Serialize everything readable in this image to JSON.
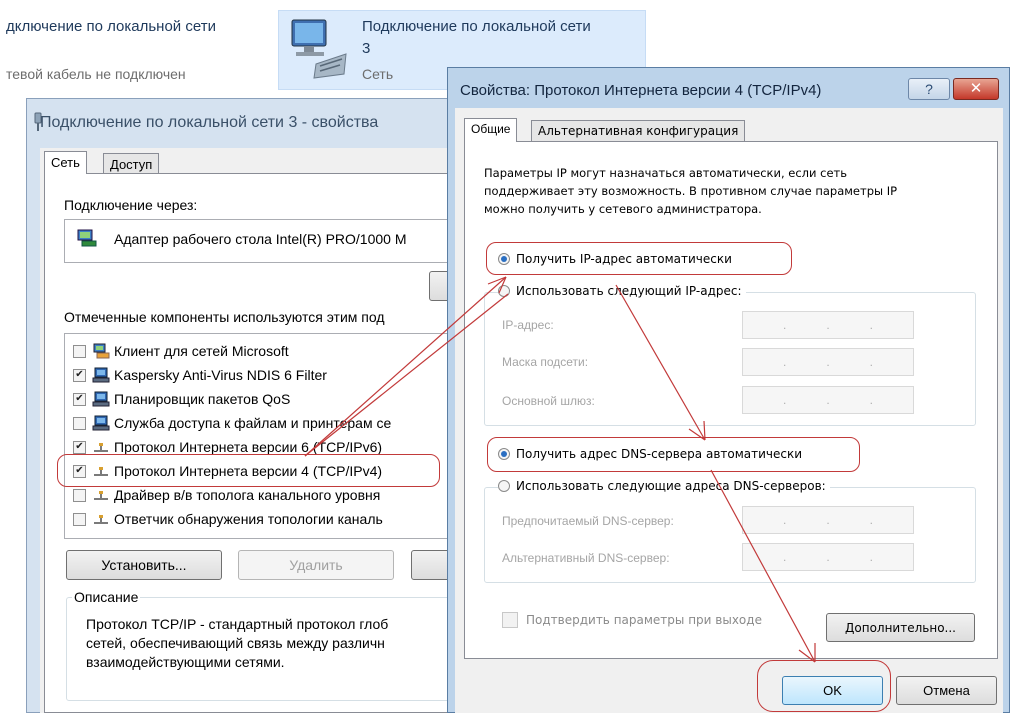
{
  "top_strip": {
    "item1_title": "дключение по локальной сети",
    "item1_status": "тевой кабель не подключен",
    "item2_title_line1": "Подключение по локальной сети",
    "item2_title_line2": "3",
    "item2_status": "Сеть"
  },
  "properties_window": {
    "title": "Подключение по локальной сети 3 - свойства",
    "tabs": [
      "Сеть",
      "Доступ"
    ],
    "connect_via_label": "Подключение через:",
    "adapter_name": "Адаптер рабочего стола Intel(R) PRO/1000 M",
    "components_label": "Отмеченные компоненты используются этим под",
    "components": [
      {
        "label": "Клиент для сетей Microsoft",
        "checked": false,
        "icon": "network-client-icon"
      },
      {
        "label": "Kaspersky Anti-Virus NDIS 6 Filter",
        "checked": true,
        "icon": "network-service-icon"
      },
      {
        "label": "Планировщик пакетов QoS",
        "checked": true,
        "icon": "network-service-icon"
      },
      {
        "label": "Служба доступа к файлам и принтерам се",
        "checked": false,
        "icon": "network-service-icon"
      },
      {
        "label": "Протокол Интернета версии 6 (TCP/IPv6)",
        "checked": true,
        "icon": "protocol-icon"
      },
      {
        "label": "Протокол Интернета версии 4 (TCP/IPv4)",
        "checked": true,
        "icon": "protocol-icon"
      },
      {
        "label": "Драйвер в/в тополога канального уровня",
        "checked": false,
        "icon": "protocol-icon"
      },
      {
        "label": "Ответчик обнаружения топологии каналь",
        "checked": false,
        "icon": "protocol-icon"
      }
    ],
    "install_button": "Установить...",
    "remove_button": "Удалить",
    "description_legend": "Описание",
    "description_text_1": "Протокол TCP/IP - стандартный протокол глоб",
    "description_text_2": "сетей, обеспечивающий связь между различн",
    "description_text_3": "взаимодействующими сетями."
  },
  "ipv4_dialog": {
    "title": "Свойства: Протокол Интернета версии 4 (TCP/IPv4)",
    "help_button": "?",
    "close_button": "✕",
    "tabs": [
      "Общие",
      "Альтернативная конфигурация"
    ],
    "intro_1": "Параметры IP могут назначаться автоматически, если сеть",
    "intro_2": "поддерживает эту возможность. В противном случае параметры IP",
    "intro_3": "можно получить у сетевого администратора.",
    "radio_ip_auto": "Получить IP-адрес автоматически",
    "radio_ip_manual": "Использовать следующий IP-адрес:",
    "ip_address_label": "IP-адрес:",
    "subnet_label": "Маска подсети:",
    "gateway_label": "Основной шлюз:",
    "radio_dns_auto": "Получить адрес DNS-сервера автоматически",
    "radio_dns_manual": "Использовать следующие адреса DNS-серверов:",
    "preferred_dns_label": "Предпочитаемый DNS-сервер:",
    "alternate_dns_label": "Альтернативный DNS-сервер:",
    "ip_dot": ".",
    "validate_checkbox": "Подтвердить параметры при выходе",
    "advanced_button": "Дополнительно...",
    "ok_button": "OK",
    "cancel_button": "Отмена",
    "selected": {
      "ip_auto": true,
      "dns_auto": true,
      "validate": false
    }
  },
  "annotation_color": "#c23a3a"
}
